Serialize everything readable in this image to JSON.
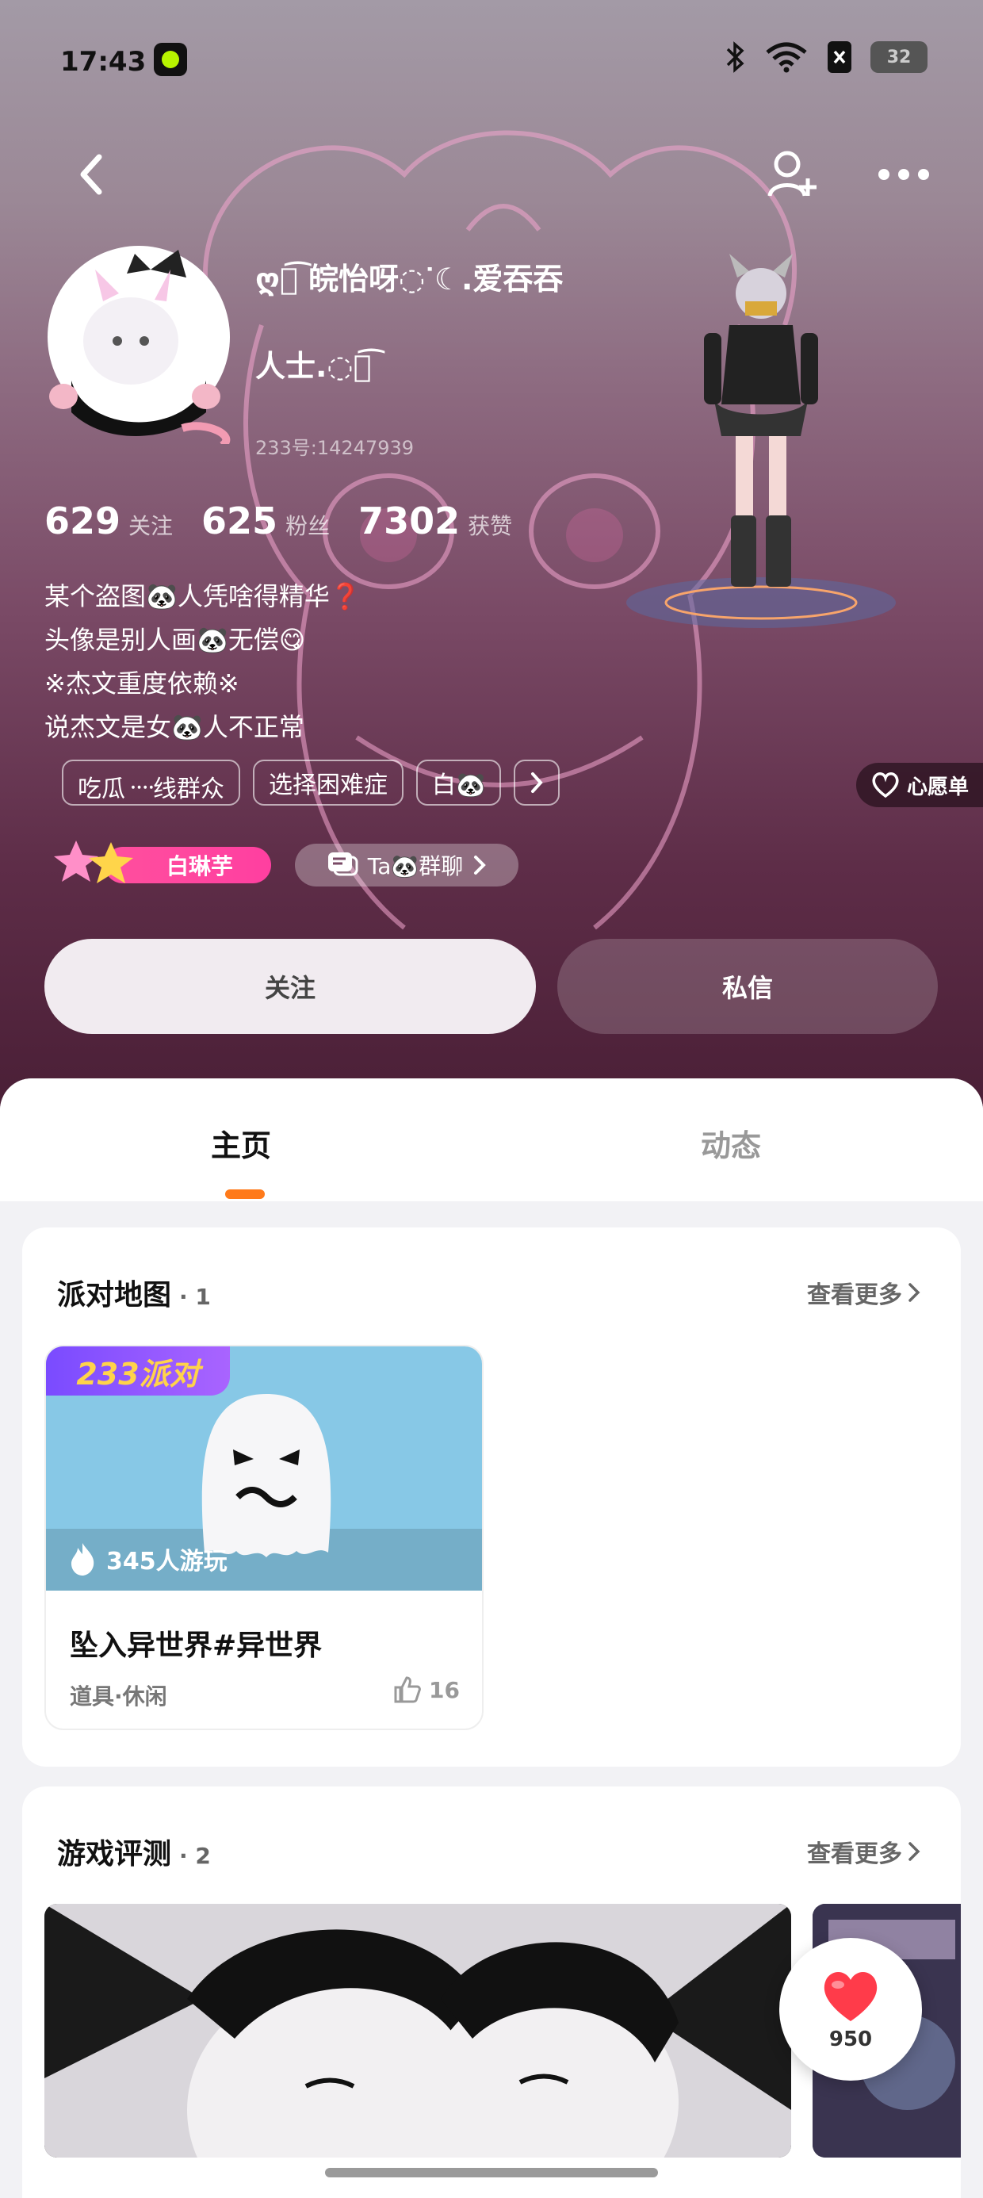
{
  "status_bar": {
    "time": "17:43",
    "battery": "32"
  },
  "profile": {
    "nickname_line1": "ღ꒰͡ 皖怡呀◌ᐝ☾.爱吞吞",
    "nickname_line2": "人士.◌꒱͡",
    "uid": "233号:14247939",
    "stats": [
      {
        "value": "629",
        "label": "关注"
      },
      {
        "value": "625",
        "label": "粉丝"
      },
      {
        "value": "7302",
        "label": "获赞"
      }
    ],
    "bio": [
      "某个盗图🐼人凭啥得精华❓",
      "头像是别人画🐼无偿😋",
      "※杰文重度依赖※",
      "说杰文是女🐼人不正常"
    ],
    "tags": [
      "吃瓜᠁线群众",
      "选择困难症",
      "白🐼"
    ],
    "wishlist": "心愿单",
    "badge_name": "白琳芋",
    "group_chat": "Ta🐼群聊",
    "follow": "关注",
    "message": "私信"
  },
  "tabs": {
    "home": "主页",
    "moments": "动态"
  },
  "party_maps": {
    "title": "派对地图",
    "count": "· 1",
    "see_more": "查看更多",
    "items": [
      {
        "brand": "233派对",
        "players": "345人游玩",
        "name": "坠入异世界#异世界",
        "category": "道具·休闲",
        "likes": "16"
      }
    ]
  },
  "game_reviews": {
    "title": "游戏评测",
    "count": "· 2",
    "see_more": "查看更多"
  },
  "like_fab": {
    "count": "950"
  },
  "colors": {
    "accent": "#ff7a1a",
    "badge_pink": "#ff4f9e",
    "like_red": "#ff3b4a"
  }
}
